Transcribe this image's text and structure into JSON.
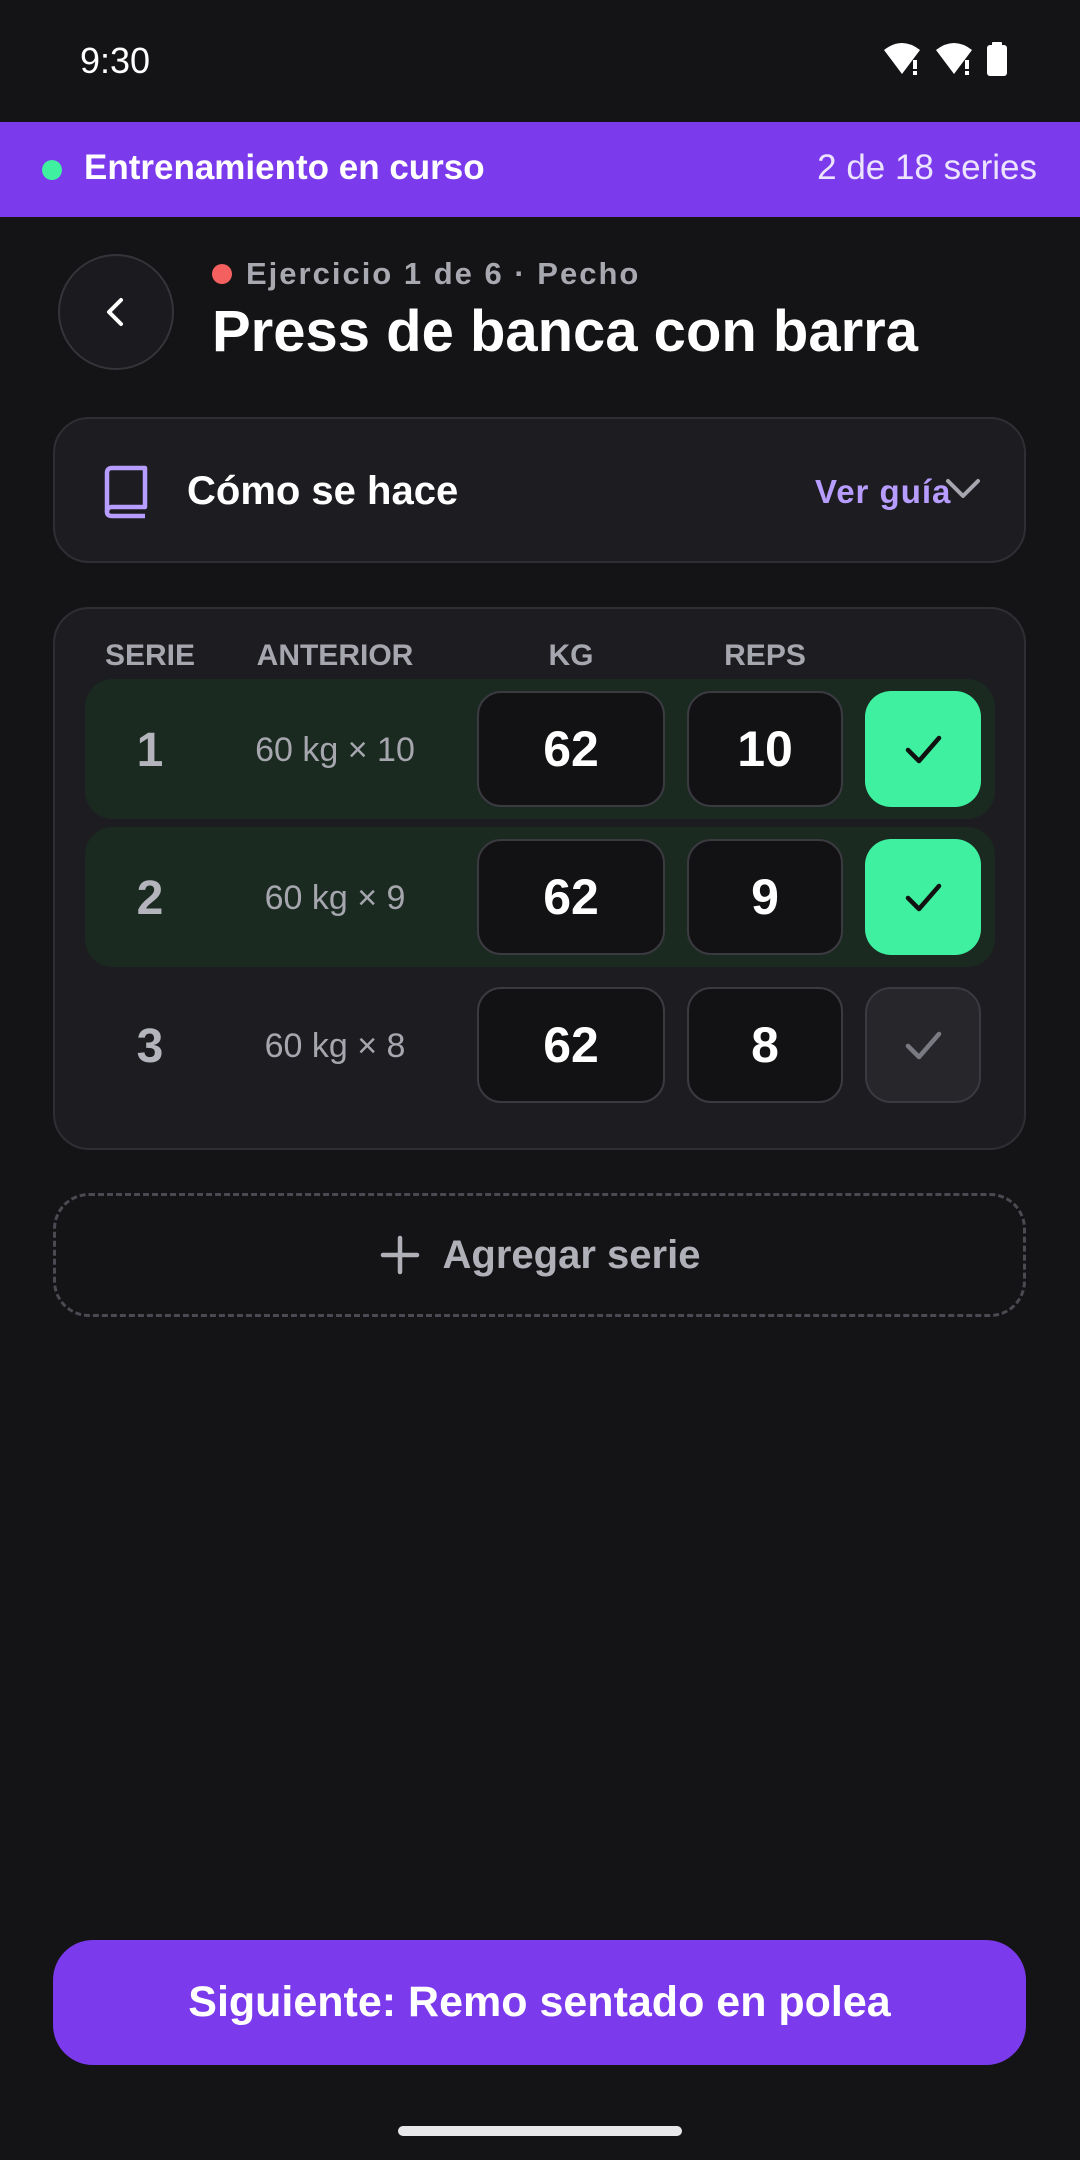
{
  "status_bar": {
    "time": "9:30",
    "icons": [
      "wifi-icon",
      "wifi-icon",
      "battery-icon"
    ]
  },
  "banner": {
    "title": "Entrenamiento en curso",
    "count": "2 de 18 series",
    "indicator_color": "#3ef0a0"
  },
  "header": {
    "eyebrow": "Ejercicio 1 de 6 · Pecho",
    "title": "Press de banca con barra",
    "back_icon": "chevron-left-icon"
  },
  "guide": {
    "label": "Cómo se hace",
    "link": "Ver guía",
    "icon": "book-icon"
  },
  "sets_table": {
    "columns": [
      "SERIE",
      "ANTERIOR",
      "KG",
      "REPS"
    ],
    "rows": [
      {
        "serie": "1",
        "anterior": "60 kg × 10",
        "kg": "62",
        "reps": "10",
        "done": true
      },
      {
        "serie": "2",
        "anterior": "60 kg × 9",
        "kg": "62",
        "reps": "9",
        "done": true
      },
      {
        "serie": "3",
        "anterior": "60 kg × 8",
        "kg": "62",
        "reps": "8",
        "done": false
      }
    ]
  },
  "add_set": {
    "label": "Agregar serie"
  },
  "next_button": {
    "label": "Siguiente: Remo sentado en polea"
  },
  "colors": {
    "accent": "#7c3aed",
    "done": "#3ef0a0",
    "background": "#141416"
  }
}
